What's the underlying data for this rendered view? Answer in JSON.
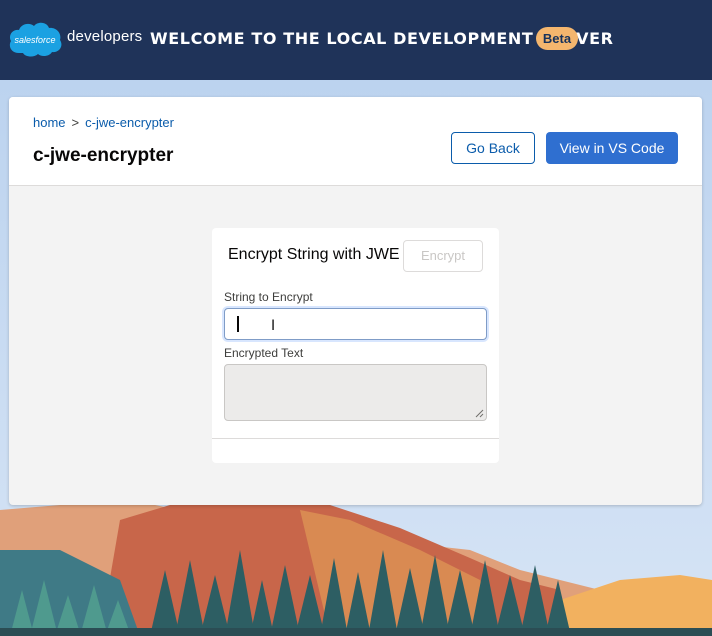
{
  "header": {
    "logo_text": "salesforce",
    "logo_suffix": "developers",
    "welcome": "WELCOME TO THE LOCAL DEVELOPMENT SERVER",
    "beta_badge": "Beta",
    "bg_color": "#1f3359"
  },
  "breadcrumb": {
    "home": "home",
    "separator": ">",
    "current": "c-jwe-encrypter"
  },
  "page": {
    "title": "c-jwe-encrypter",
    "go_back": "Go Back",
    "view_vscode": "View in VS Code"
  },
  "card": {
    "title": "Encrypt String with JWE",
    "encrypt_button": "Encrypt",
    "string_label": "String to Encrypt",
    "string_value": "",
    "encrypted_label": "Encrypted Text",
    "encrypted_value": ""
  },
  "colors": {
    "accent": "#2f6fd0",
    "link": "#0b5cab",
    "beta": "#f4b66e"
  }
}
